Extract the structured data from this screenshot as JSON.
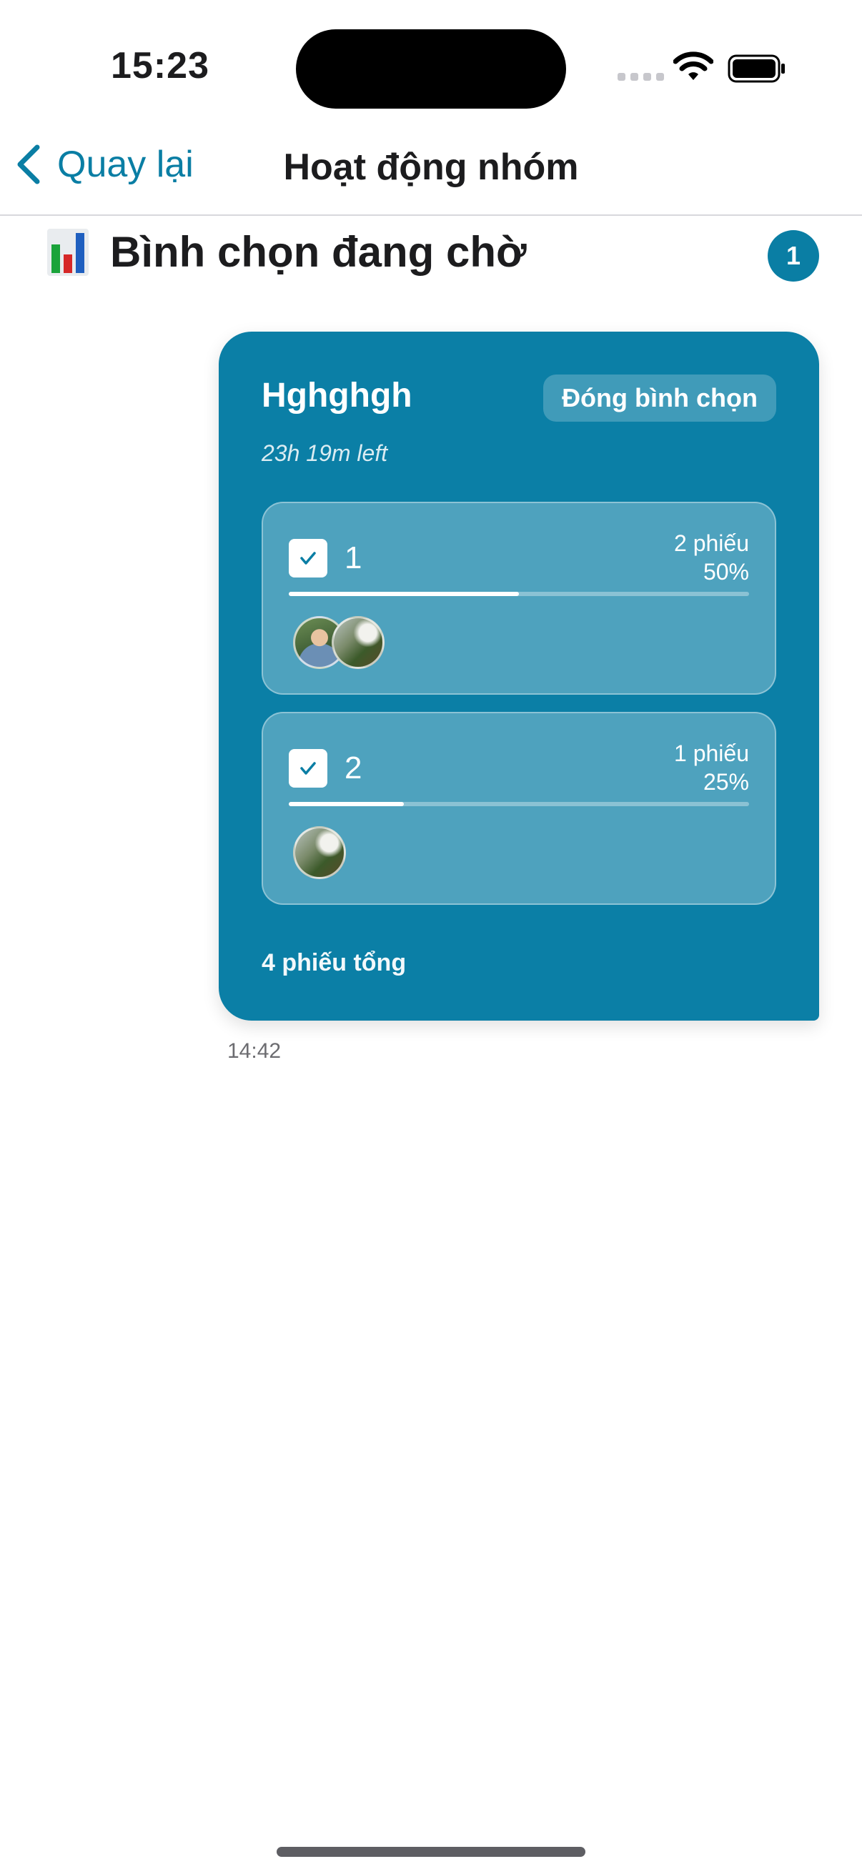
{
  "status_bar": {
    "time": "15:23"
  },
  "nav": {
    "back_label": "Quay lại",
    "title": "Hoạt động nhóm"
  },
  "section": {
    "icon": "bar-chart-icon",
    "title": "Bình chọn đang chờ",
    "count": "1"
  },
  "poll": {
    "question": "Hghghgh",
    "close_label": "Đóng bình chọn",
    "time_left": "23h 19m left",
    "options": [
      {
        "label": "1",
        "votes": "2 phiếu",
        "percent": "50%",
        "progress": 0.5,
        "checked": true,
        "voters": [
          "person",
          "landscape"
        ]
      },
      {
        "label": "2",
        "votes": "1 phiếu",
        "percent": "25%",
        "progress": 0.25,
        "checked": true,
        "voters": [
          "landscape"
        ]
      }
    ],
    "total": "4 phiếu tổng",
    "sent_time": "14:42"
  },
  "colors": {
    "accent": "#0a7ea4",
    "card": "#0b7fa6"
  }
}
